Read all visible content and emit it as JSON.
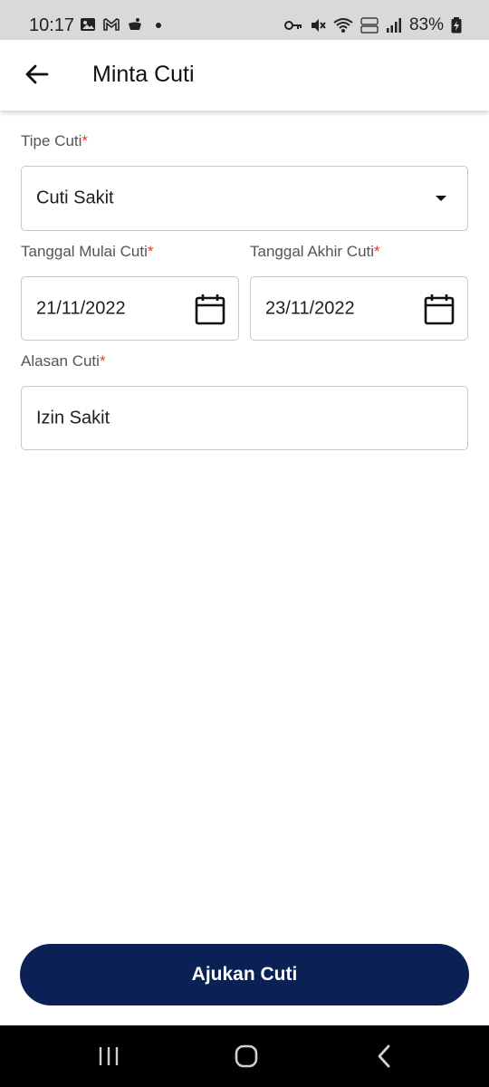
{
  "status_bar": {
    "time": "10:17",
    "battery": "83%"
  },
  "app_bar": {
    "title": "Minta Cuti",
    "back_icon": "arrow-left-icon"
  },
  "form": {
    "leave_type": {
      "label": "Tipe Cuti",
      "required_mark": "*",
      "value": "Cuti Sakit",
      "icon": "dropdown-caret-icon"
    },
    "start_date": {
      "label": "Tanggal Mulai Cuti",
      "required_mark": "*",
      "value": "21/11/2022",
      "icon": "calendar-icon"
    },
    "end_date": {
      "label": "Tanggal Akhir Cuti",
      "required_mark": "*",
      "value": "23/11/2022",
      "icon": "calendar-icon"
    },
    "reason": {
      "label": "Alasan Cuti",
      "required_mark": "*",
      "value": "Izin Sakit"
    }
  },
  "submit": {
    "label": "Ajukan Cuti"
  },
  "colors": {
    "primary": "#0b2155",
    "required": "#e53935",
    "status_bar_bg": "#d9d9d9",
    "nav_bar_bg": "#000000"
  }
}
